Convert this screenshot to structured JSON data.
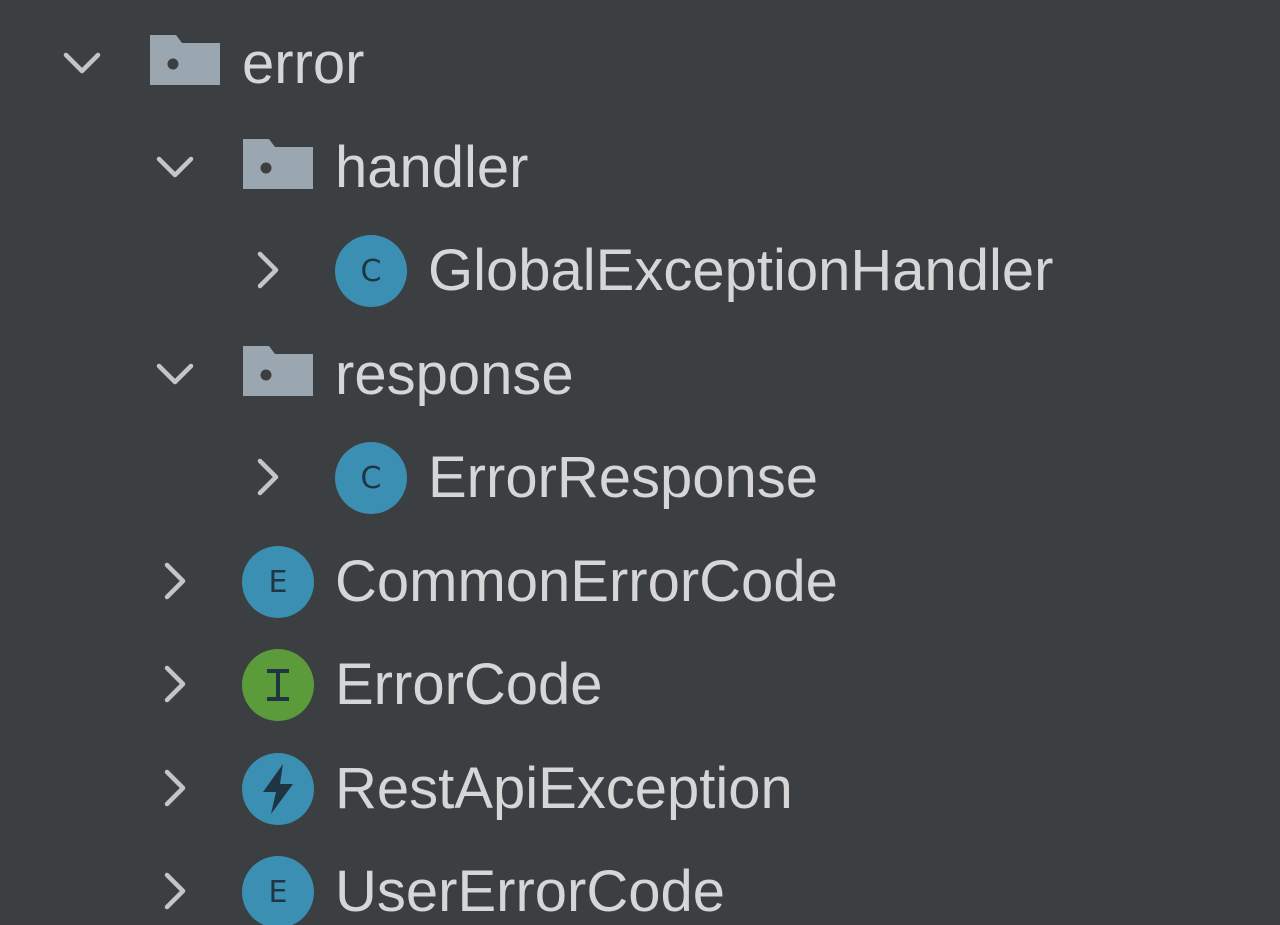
{
  "project_tree": {
    "items": [
      {
        "label": "error",
        "kind": "package",
        "icon": "package-folder-icon",
        "expanded": true,
        "depth": 0
      },
      {
        "label": "handler",
        "kind": "package",
        "icon": "package-folder-icon",
        "expanded": true,
        "depth": 1
      },
      {
        "label": "GlobalExceptionHandler",
        "kind": "class",
        "icon": "class-icon",
        "icon_letter": "C",
        "expanded": false,
        "depth": 2
      },
      {
        "label": "response",
        "kind": "package",
        "icon": "package-folder-icon",
        "expanded": true,
        "depth": 1
      },
      {
        "label": "ErrorResponse",
        "kind": "class",
        "icon": "class-icon",
        "icon_letter": "C",
        "expanded": false,
        "depth": 2
      },
      {
        "label": "CommonErrorCode",
        "kind": "enum",
        "icon": "enum-icon",
        "icon_letter": "E",
        "expanded": false,
        "depth": 1
      },
      {
        "label": "ErrorCode",
        "kind": "interface",
        "icon": "interface-icon",
        "icon_letter": "I",
        "expanded": false,
        "depth": 1
      },
      {
        "label": "RestApiException",
        "kind": "exception",
        "icon": "exception-icon",
        "expanded": false,
        "depth": 1
      },
      {
        "label": "UserErrorCode",
        "kind": "enum",
        "icon": "enum-icon",
        "icon_letter": "E",
        "expanded": false,
        "depth": 1
      }
    ]
  },
  "colors": {
    "background": "#3c3f41",
    "text": "#d6d6d6",
    "chevron": "#c5c5c5",
    "folder": "#9aa7b0",
    "class_blue": "#3b8fb3",
    "interface_green": "#5b9b3a",
    "glyph_dark": "#1f3541"
  }
}
